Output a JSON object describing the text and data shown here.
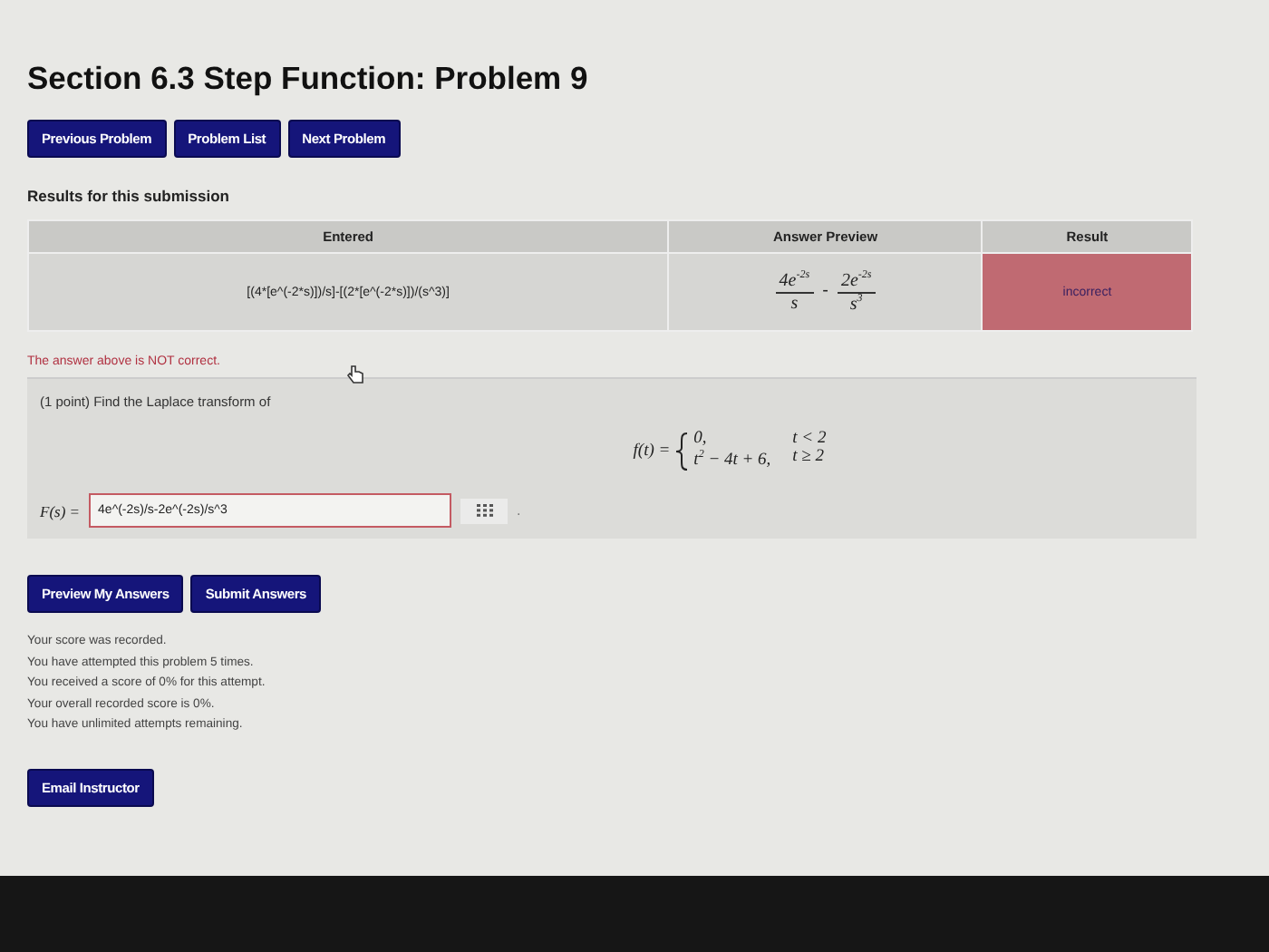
{
  "title": "Section 6.3 Step Function: Problem 9",
  "nav_buttons": [
    "Previous Problem",
    "Problem List",
    "Next Problem"
  ],
  "results_heading": "Results for this submission",
  "results_table": {
    "columns": [
      "Entered",
      "Answer Preview",
      "Result"
    ],
    "rows": [
      {
        "entered": "[(4*[e^(-2*s)])/s]-[(2*[e^(-2*s)])/(s^3)]",
        "preview": {
          "terms": [
            {
              "num": "4e$^{-2s}$",
              "den": "s"
            },
            {
              "num": "2e$^{-2s}$",
              "den": "s$^{3}$"
            }
          ],
          "operator": "-"
        },
        "result": "incorrect",
        "correct": false
      }
    ]
  },
  "feedback": "The answer above is NOT correct.",
  "problem": {
    "prompt": "(1 point) Find the Laplace transform of",
    "function_label": "f(t) =",
    "cases": [
      {
        "expr": "0,",
        "cond": "t < 2"
      },
      {
        "expr": "t$^{2}$ − 4t + 6,",
        "cond": "t ≥ 2"
      }
    ],
    "answer": {
      "label": "F(s) =",
      "value": "4e^(-2s)/s-2e^(-2s)/s^3",
      "marked_incorrect": true,
      "after": "."
    }
  },
  "action_buttons": [
    "Preview My Answers",
    "Submit Answers"
  ],
  "messages": [
    "Your score was recorded.",
    "You have attempted this problem 5 times.",
    "You received a score of 0% for this attempt.",
    "Your overall recorded score is 0%.",
    "You have unlimited attempts remaining."
  ],
  "email_button": "Email Instructor"
}
